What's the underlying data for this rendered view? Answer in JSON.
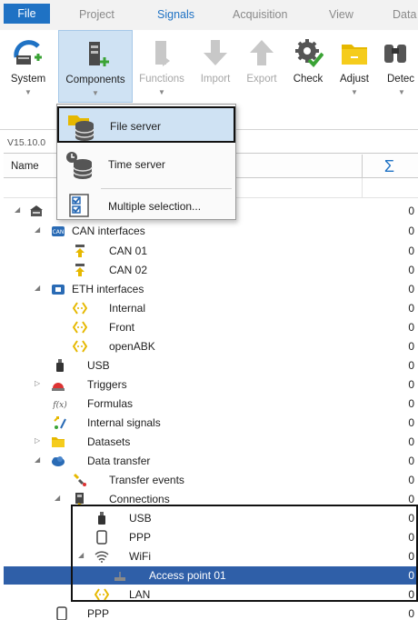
{
  "tabs": [
    "File",
    "Project",
    "Signals",
    "Acquisition",
    "View",
    "Data"
  ],
  "ribbon": {
    "buttons": [
      {
        "label": "System",
        "has_arrow": true
      },
      {
        "label": "Components",
        "has_arrow": true
      },
      {
        "label": "Functions",
        "has_arrow": true
      },
      {
        "label": "Import",
        "has_arrow": false
      },
      {
        "label": "Export",
        "has_arrow": false
      },
      {
        "label": "Check",
        "has_arrow": false
      },
      {
        "label": "Adjust",
        "has_arrow": true
      },
      {
        "label": "Detec",
        "has_arrow": true
      }
    ],
    "arrow_glyph": "▼"
  },
  "version": "V15.10.0",
  "columns": {
    "name": "Name",
    "sum": "Σ"
  },
  "menu": {
    "items": [
      "File server",
      "Time server",
      "Multiple selection..."
    ]
  },
  "tree": {
    "rows": [
      {
        "label": "",
        "value": "0"
      },
      {
        "label": "CAN interfaces",
        "value": "0"
      },
      {
        "label": "CAN 01",
        "value": "0"
      },
      {
        "label": "CAN 02",
        "value": "0"
      },
      {
        "label": "ETH interfaces",
        "value": "0"
      },
      {
        "label": "Internal",
        "value": "0"
      },
      {
        "label": "Front",
        "value": "0"
      },
      {
        "label": "openABK",
        "value": "0"
      },
      {
        "label": "USB",
        "value": "0"
      },
      {
        "label": "Triggers",
        "value": "0"
      },
      {
        "label": "Formulas",
        "value": "0"
      },
      {
        "label": "Internal signals",
        "value": "0"
      },
      {
        "label": "Datasets",
        "value": "0"
      },
      {
        "label": "Data transfer",
        "value": "0"
      },
      {
        "label": "Transfer events",
        "value": "0"
      },
      {
        "label": "Connections",
        "value": "0"
      },
      {
        "label": "USB",
        "value": "0"
      },
      {
        "label": "PPP",
        "value": "0"
      },
      {
        "label": "WiFi",
        "value": "0"
      },
      {
        "label": "Access point 01",
        "value": "0"
      },
      {
        "label": "LAN",
        "value": "0"
      },
      {
        "label": "PPP",
        "value": "0"
      }
    ],
    "expander_open": "◢",
    "expander_closed": "▷"
  },
  "colors": {
    "accent": "#1f72c4",
    "selection": "#2f5fa8",
    "menu_highlight": "#cfe2f3"
  }
}
